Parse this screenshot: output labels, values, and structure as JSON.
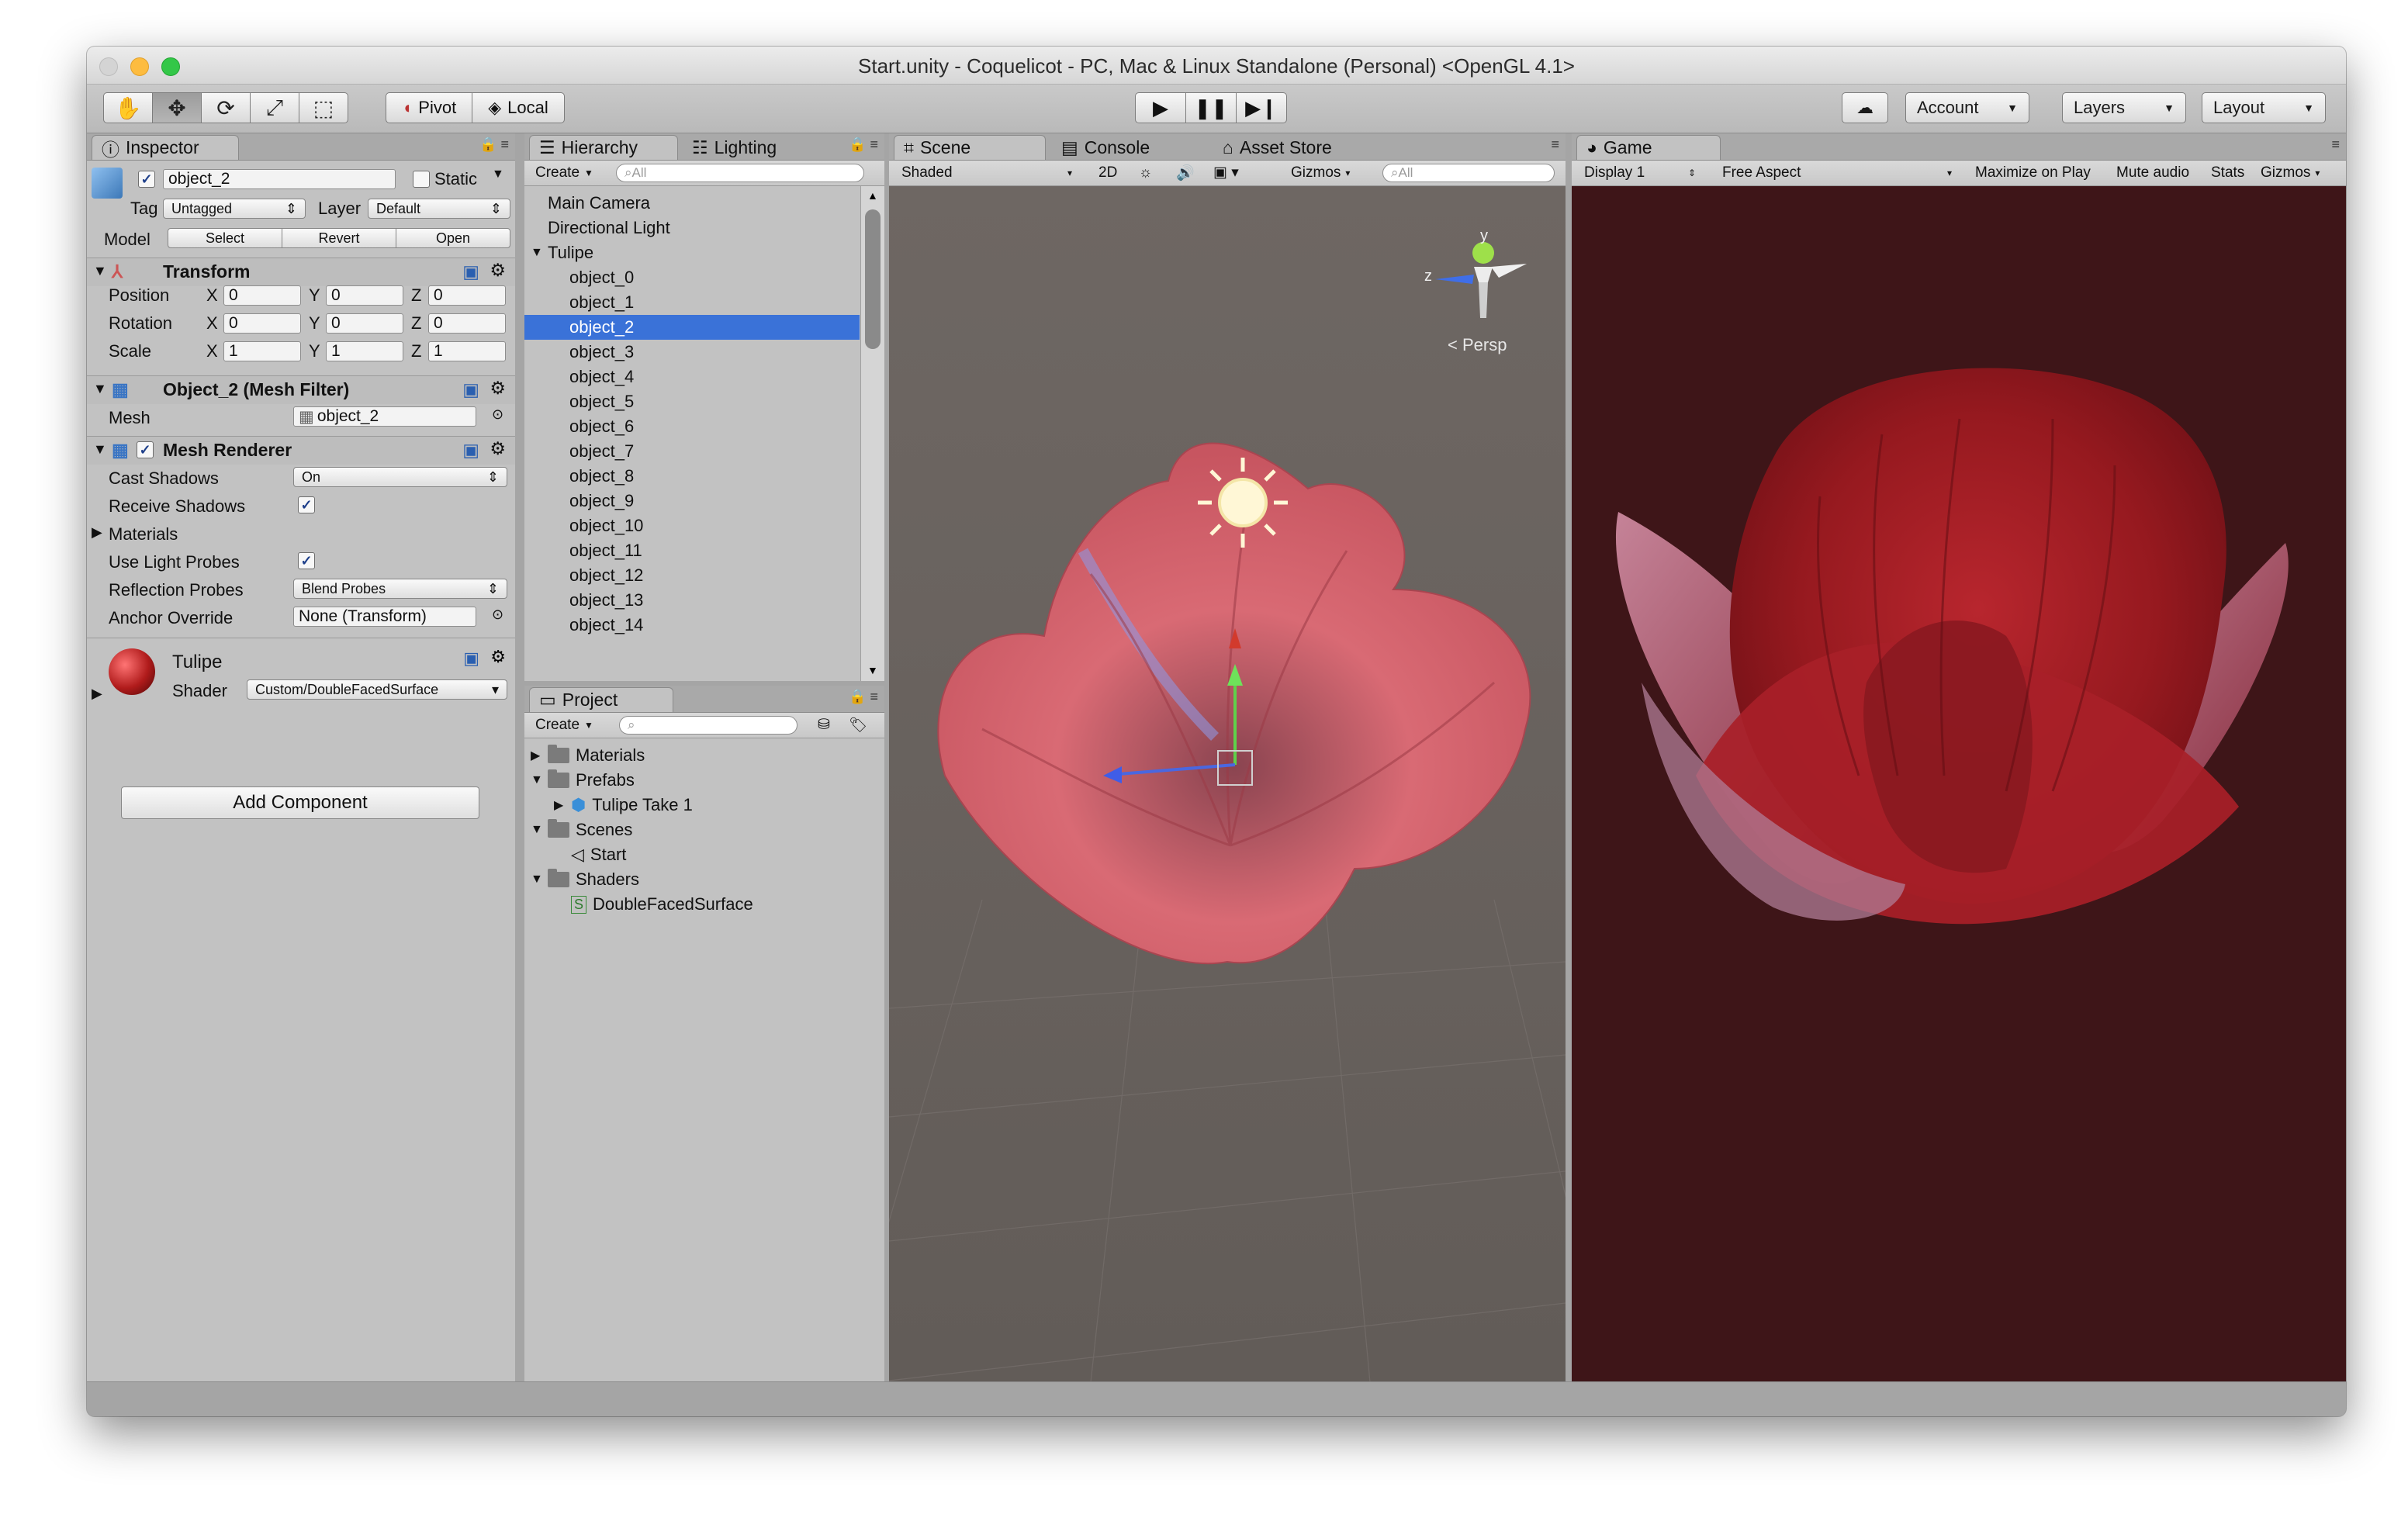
{
  "window": {
    "title": "Start.unity - Coquelicot - PC, Mac & Linux Standalone (Personal) <OpenGL 4.1>"
  },
  "toolbar": {
    "pivot": "Pivot",
    "local": "Local",
    "account": "Account",
    "layers": "Layers",
    "layout": "Layout"
  },
  "inspector": {
    "tab": "Inspector",
    "object_name": "object_2",
    "static_label": "Static",
    "tag_label": "Tag",
    "tag_value": "Untagged",
    "layer_label": "Layer",
    "layer_value": "Default",
    "model_label": "Model",
    "model_buttons": [
      "Select",
      "Revert",
      "Open"
    ],
    "transform": {
      "title": "Transform",
      "rows": [
        {
          "label": "Position",
          "x": "0",
          "y": "0",
          "z": "0"
        },
        {
          "label": "Rotation",
          "x": "0",
          "y": "0",
          "z": "0"
        },
        {
          "label": "Scale",
          "x": "1",
          "y": "1",
          "z": "1"
        }
      ],
      "axis": [
        "X",
        "Y",
        "Z"
      ]
    },
    "mesh_filter": {
      "title": "Object_2 (Mesh Filter)",
      "mesh_label": "Mesh",
      "mesh_value": "object_2"
    },
    "mesh_renderer": {
      "title": "Mesh Renderer",
      "cast_shadows_label": "Cast Shadows",
      "cast_shadows_value": "On",
      "receive_shadows_label": "Receive Shadows",
      "materials_label": "Materials",
      "light_probes_label": "Use Light Probes",
      "reflection_probes_label": "Reflection Probes",
      "reflection_probes_value": "Blend Probes",
      "anchor_label": "Anchor Override",
      "anchor_value": "None (Transform)"
    },
    "material": {
      "name": "Tulipe",
      "shader_label": "Shader",
      "shader_value": "Custom/DoubleFacedSurface"
    },
    "add_component": "Add Component"
  },
  "hierarchy": {
    "tabs": [
      "Hierarchy",
      "Lighting"
    ],
    "create": "Create",
    "search_placeholder": "All",
    "items": [
      {
        "label": "Main Camera",
        "level": 0
      },
      {
        "label": "Directional Light",
        "level": 0
      },
      {
        "label": "Tulipe",
        "level": 0,
        "expanded": true
      },
      {
        "label": "object_0",
        "level": 1
      },
      {
        "label": "object_1",
        "level": 1
      },
      {
        "label": "object_2",
        "level": 1,
        "selected": true
      },
      {
        "label": "object_3",
        "level": 1
      },
      {
        "label": "object_4",
        "level": 1
      },
      {
        "label": "object_5",
        "level": 1
      },
      {
        "label": "object_6",
        "level": 1
      },
      {
        "label": "object_7",
        "level": 1
      },
      {
        "label": "object_8",
        "level": 1
      },
      {
        "label": "object_9",
        "level": 1
      },
      {
        "label": "object_10",
        "level": 1
      },
      {
        "label": "object_11",
        "level": 1
      },
      {
        "label": "object_12",
        "level": 1
      },
      {
        "label": "object_13",
        "level": 1
      },
      {
        "label": "object_14",
        "level": 1
      }
    ]
  },
  "project": {
    "tab": "Project",
    "create": "Create",
    "items": [
      {
        "label": "Materials",
        "level": 0,
        "type": "folder",
        "expanded": false
      },
      {
        "label": "Prefabs",
        "level": 0,
        "type": "folder",
        "expanded": true
      },
      {
        "label": "Tulipe Take 1",
        "level": 1,
        "type": "prefab"
      },
      {
        "label": "Scenes",
        "level": 0,
        "type": "folder",
        "expanded": true
      },
      {
        "label": "Start",
        "level": 1,
        "type": "scene"
      },
      {
        "label": "Shaders",
        "level": 0,
        "type": "folder",
        "expanded": true
      },
      {
        "label": "DoubleFacedSurface",
        "level": 1,
        "type": "shader"
      }
    ]
  },
  "scene": {
    "tabs": [
      "Scene",
      "Console",
      "Asset Store"
    ],
    "shading": "Shaded",
    "mode_2d": "2D",
    "gizmos": "Gizmos",
    "search_placeholder": "All",
    "persp_label": "Persp",
    "axis_y": "y",
    "axis_z": "z",
    "background": "#6b6461",
    "flower_color": "#d96a74"
  },
  "game": {
    "tab": "Game",
    "display": "Display 1",
    "aspect": "Free Aspect",
    "maximize": "Maximize on Play",
    "mute": "Mute audio",
    "stats": "Stats",
    "gizmos": "Gizmos",
    "background": "#3e1518",
    "flower_color": "#9a1d24"
  },
  "colors": {
    "selection": "#3a72d8",
    "panel": "#c2c2c2"
  }
}
